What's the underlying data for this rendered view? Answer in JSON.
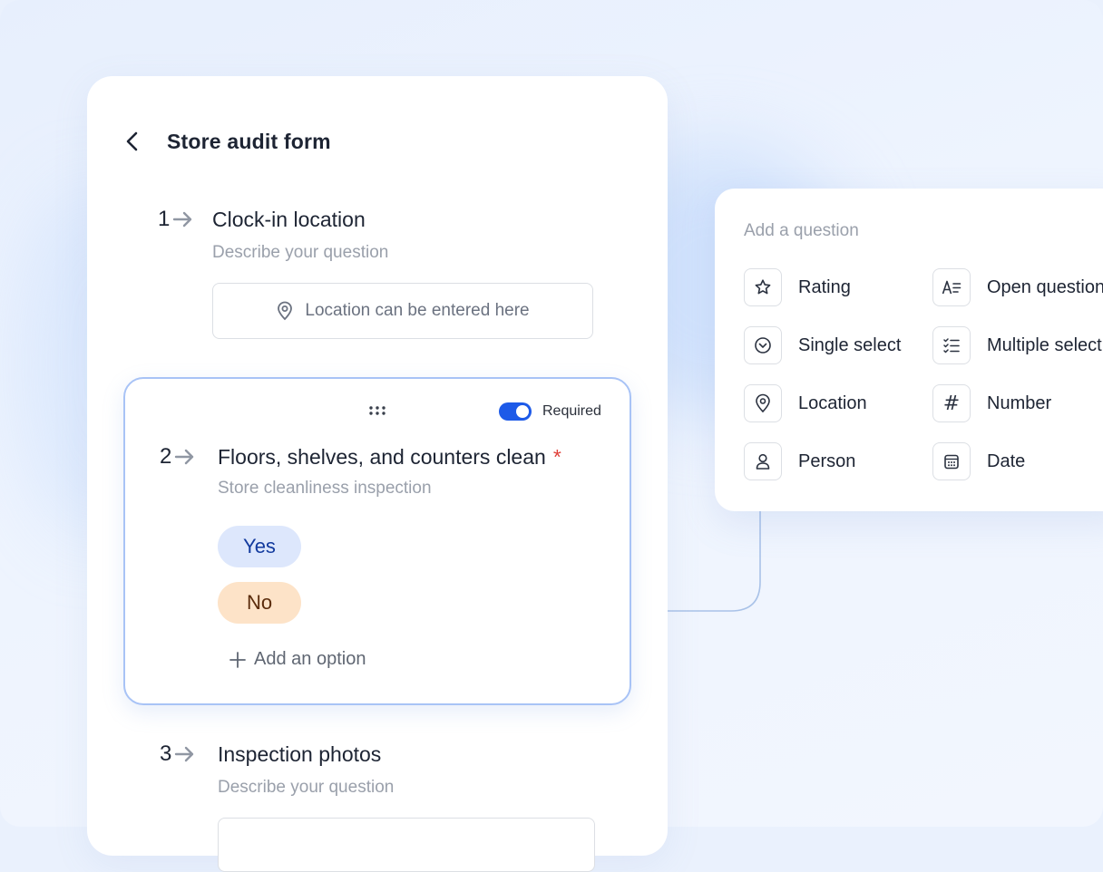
{
  "form": {
    "title": "Store audit form",
    "questions": [
      {
        "number": "1",
        "title": "Clock-in location",
        "description": "Describe your question",
        "input_placeholder": "Location can be entered here"
      },
      {
        "number": "2",
        "title": "Floors, shelves, and counters clean",
        "required_marker": "*",
        "description": "Store cleanliness inspection",
        "required_label": "Required",
        "options": [
          "Yes",
          "No"
        ],
        "add_option_label": "Add an option"
      },
      {
        "number": "3",
        "title": "Inspection photos",
        "description": "Describe your question"
      }
    ]
  },
  "panel": {
    "title": "Add a question",
    "types": [
      {
        "label": "Rating",
        "icon": "star-icon"
      },
      {
        "label": "Open question",
        "icon": "text-lines-icon"
      },
      {
        "label": "Single select",
        "icon": "chevron-circle-icon"
      },
      {
        "label": "Multiple select",
        "icon": "checklist-icon"
      },
      {
        "label": "Location",
        "icon": "location-pin-icon"
      },
      {
        "label": "Number",
        "icon": "hash-icon",
        "glyph": "#"
      },
      {
        "label": "Person",
        "icon": "person-icon"
      },
      {
        "label": "Date",
        "icon": "calendar-icon"
      }
    ]
  },
  "colors": {
    "accent": "#1d5ae8",
    "card_border": "#a8c3f6",
    "yes_chip": "#dde7fc",
    "no_chip": "#fde3c8",
    "required_star": "#e0413a"
  }
}
